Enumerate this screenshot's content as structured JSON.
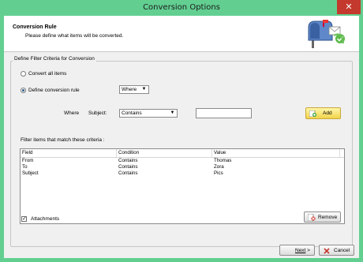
{
  "window": {
    "title": "Conversion Options",
    "close_glyph": "✕"
  },
  "header": {
    "title": "Conversion Rule",
    "subtitle": "Please define what items will be converted."
  },
  "group": {
    "legend": "Define Filter Criteria for Conversion"
  },
  "options": {
    "convert_all": "Convert all items",
    "define_rule": "Define conversion rule",
    "selected": "define_rule"
  },
  "where_combo": {
    "value": "Where"
  },
  "criteria": {
    "where_label": "Where",
    "subject_label": "Subject:",
    "condition_value": "Contains",
    "text_value": "",
    "add_label": "Add"
  },
  "filter_list": {
    "caption": "Filter items that match these criteria :",
    "columns": [
      "Field",
      "Condition",
      "Value"
    ],
    "rows": [
      [
        "From",
        "Contains",
        "Thomas"
      ],
      [
        "To",
        "Contains",
        "Zora"
      ],
      [
        "Subject",
        "Contains",
        "Pics"
      ]
    ]
  },
  "attachments": {
    "label": "Attachments",
    "checked": true
  },
  "remove_label": "Remove",
  "footer": {
    "next_label": "Next",
    "next_suffix": " >",
    "cancel_label": "Cancel"
  },
  "icons": [
    "mailbox-icon",
    "cursor-icon",
    "add-icon",
    "remove-icon",
    "close-icon",
    "dropdown-arrow-icon"
  ],
  "colors": {
    "titlebar": "#62cf91",
    "close": "#c4392d",
    "add_button": "#f2d34a"
  }
}
